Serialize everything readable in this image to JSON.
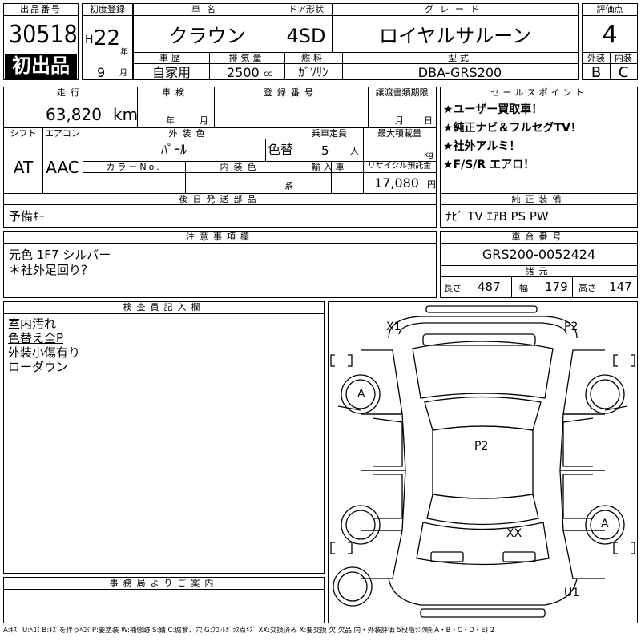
{
  "header": {
    "lot_number_label": "出品番号",
    "lot_number": "30518",
    "first_listing_badge": "初出品",
    "first_reg_label": "初度登録",
    "era": "H",
    "year": "22",
    "year_unit": "年",
    "month": "9",
    "month_unit": "月",
    "car_name_label": "車名",
    "car_name": "クラウン",
    "door_label": "ドア形状",
    "door": "4SD",
    "grade_label": "グレード",
    "grade": "ロイヤルサルーン",
    "score_label": "評価点",
    "score": "4",
    "history_label": "車歴",
    "history": "自家用",
    "displacement_label": "排気量",
    "displacement": "2500",
    "displacement_unit": "cc",
    "fuel_label": "燃料",
    "fuel": "ｶﾞｿﾘﾝ",
    "model_label": "型式",
    "model": "DBA-GRS200",
    "exterior_label": "外装",
    "exterior": "B",
    "interior_label": "内装",
    "interior": "C"
  },
  "details": {
    "mileage_label": "走行",
    "mileage": "63,820",
    "mileage_unit": "km",
    "inspection_label": "車検",
    "inspection_year_unit": "年",
    "inspection_month_unit": "月",
    "reg_no_label": "登録番号",
    "transfer_label": "譲渡書類期限",
    "transfer_month_unit": "月",
    "transfer_day_unit": "日",
    "shift_label": "シフト",
    "shift": "AT",
    "ac_label": "エアコン",
    "ac": "AAC",
    "ext_color_label": "外装色",
    "ext_color": "ﾊﾟｰﾙ",
    "color_change": "色替",
    "capacity_label": "乗車定員",
    "capacity": "5",
    "capacity_unit": "人",
    "max_load_label": "最大積載量",
    "max_load_unit": "kg",
    "color_no_label": "カラーNo.",
    "int_color_label": "内装色",
    "int_color_suffix": "系",
    "import_label": "輸入車",
    "recycle_label": "リサイクル預託金",
    "recycle": "17,080",
    "recycle_unit": "円",
    "later_parts_label": "後日発送部品",
    "later_parts": "予備ｷｰ"
  },
  "sales_points": {
    "label": "セールスポイント",
    "items": [
      "★ユーザー買取車！",
      "★純正ナビ＆フルセグTV！",
      "★社外アルミ！",
      "★F/S/R エアロ！"
    ]
  },
  "factory_equipment": {
    "label": "純正装備",
    "value": "ﾅﾋﾞ TV ｴｱB PS PW"
  },
  "notes": {
    "label": "注意事項欄",
    "lines": [
      "元色 1F7 シルバー",
      "＊社外足回り？"
    ]
  },
  "chassis": {
    "label": "車台番号",
    "value": "GRS200-0052424",
    "spec_label": "諸元",
    "length_label": "長さ",
    "length": "487",
    "width_label": "幅",
    "width": "179",
    "height_label": "高さ",
    "height": "147"
  },
  "inspector": {
    "label": "検査員記入欄",
    "lines": [
      "室内汚れ",
      "色替え全P",
      "外装小傷有り",
      "ローダウン"
    ]
  },
  "office": {
    "label": "事務局よりご案内"
  },
  "diagram": {
    "marks": {
      "x1": "X1",
      "p2_top": "P2",
      "p2_center": "P2",
      "a_fl": "A",
      "a_rr": "A",
      "xx": "XX",
      "u1": "U1"
    }
  },
  "legend": "A:ｷｽﾞ U:ﾍｺﾐ B:ｷｽﾞを伴うﾍｺﾐ P:要塗装 W:補修跡 S:錆 C:腐食、穴 G:ﾌﾛﾝﾄｶﾞﾗｽ点ｷｽﾞ XX:交換済み X:要交換 欠:欠品 内・外装評価 5段階ﾗﾝｸ順(A・B・C・D・E) 2"
}
